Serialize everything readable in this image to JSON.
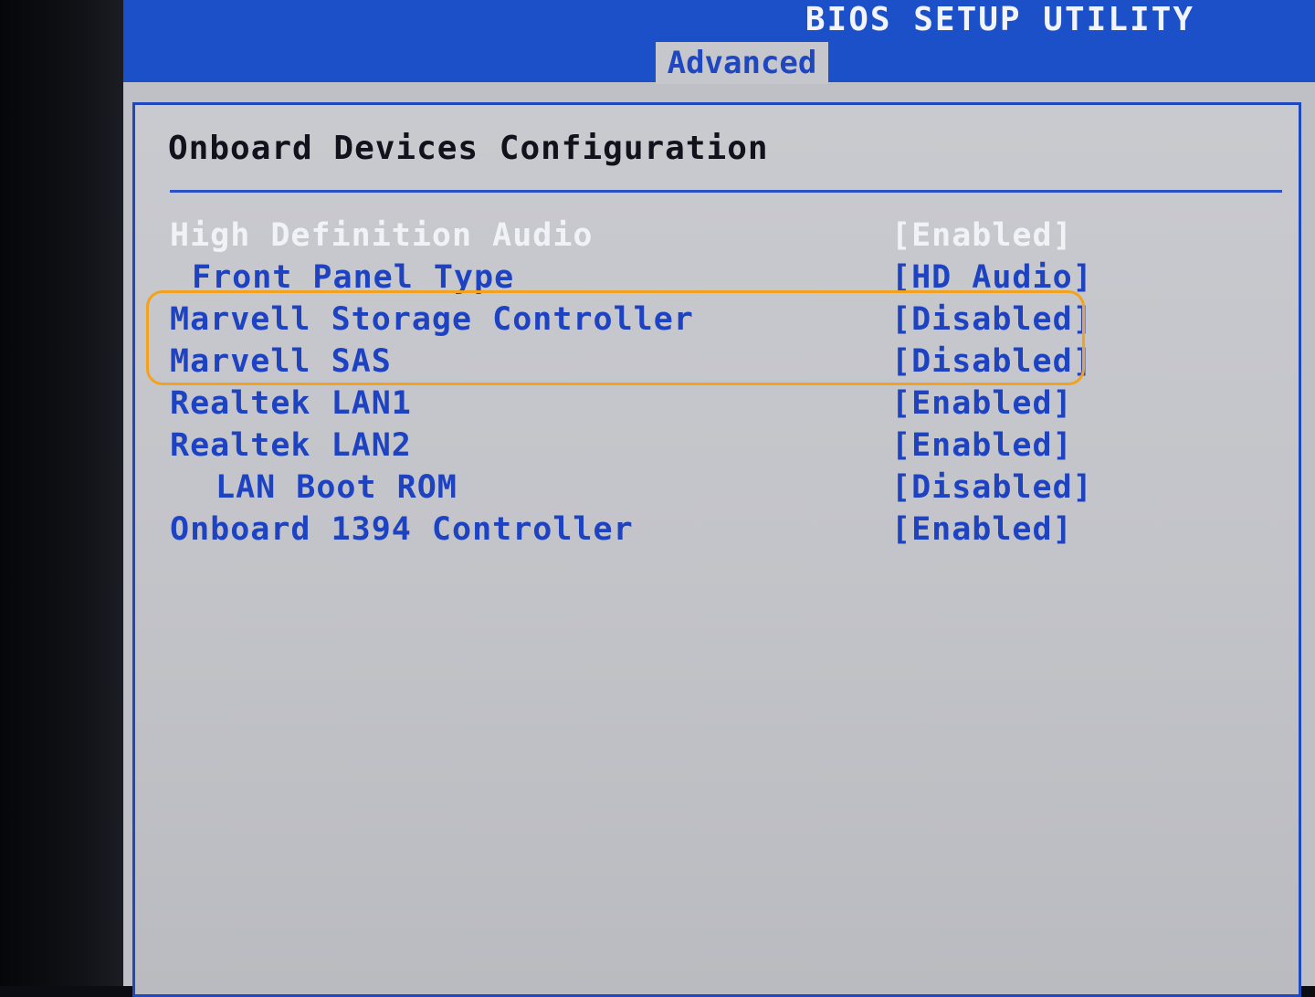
{
  "header": {
    "title": "BIOS SETUP UTILITY",
    "active_tab": "Advanced"
  },
  "panel": {
    "heading": "Onboard Devices Configuration",
    "items": [
      {
        "label": "High Definition Audio",
        "value": "[Enabled]",
        "selected": true
      },
      {
        "label": "Front Panel Type",
        "value": "[HD Audio]"
      },
      {
        "label": "Marvell Storage Controller",
        "value": "[Disabled]"
      },
      {
        "label": "Marvell SAS",
        "value": "[Disabled]"
      },
      {
        "label": "Realtek LAN1",
        "value": "[Enabled]"
      },
      {
        "label": "Realtek LAN2",
        "value": "[Enabled]"
      },
      {
        "label": "LAN Boot ROM",
        "value": "[Disabled]"
      },
      {
        "label": "Onboard 1394 Controller",
        "value": "[Enabled]"
      }
    ]
  },
  "colors": {
    "bios_blue": "#1b50c8",
    "panel_gray": "#c3c4c9",
    "highlight_orange": "#f3a21d"
  }
}
